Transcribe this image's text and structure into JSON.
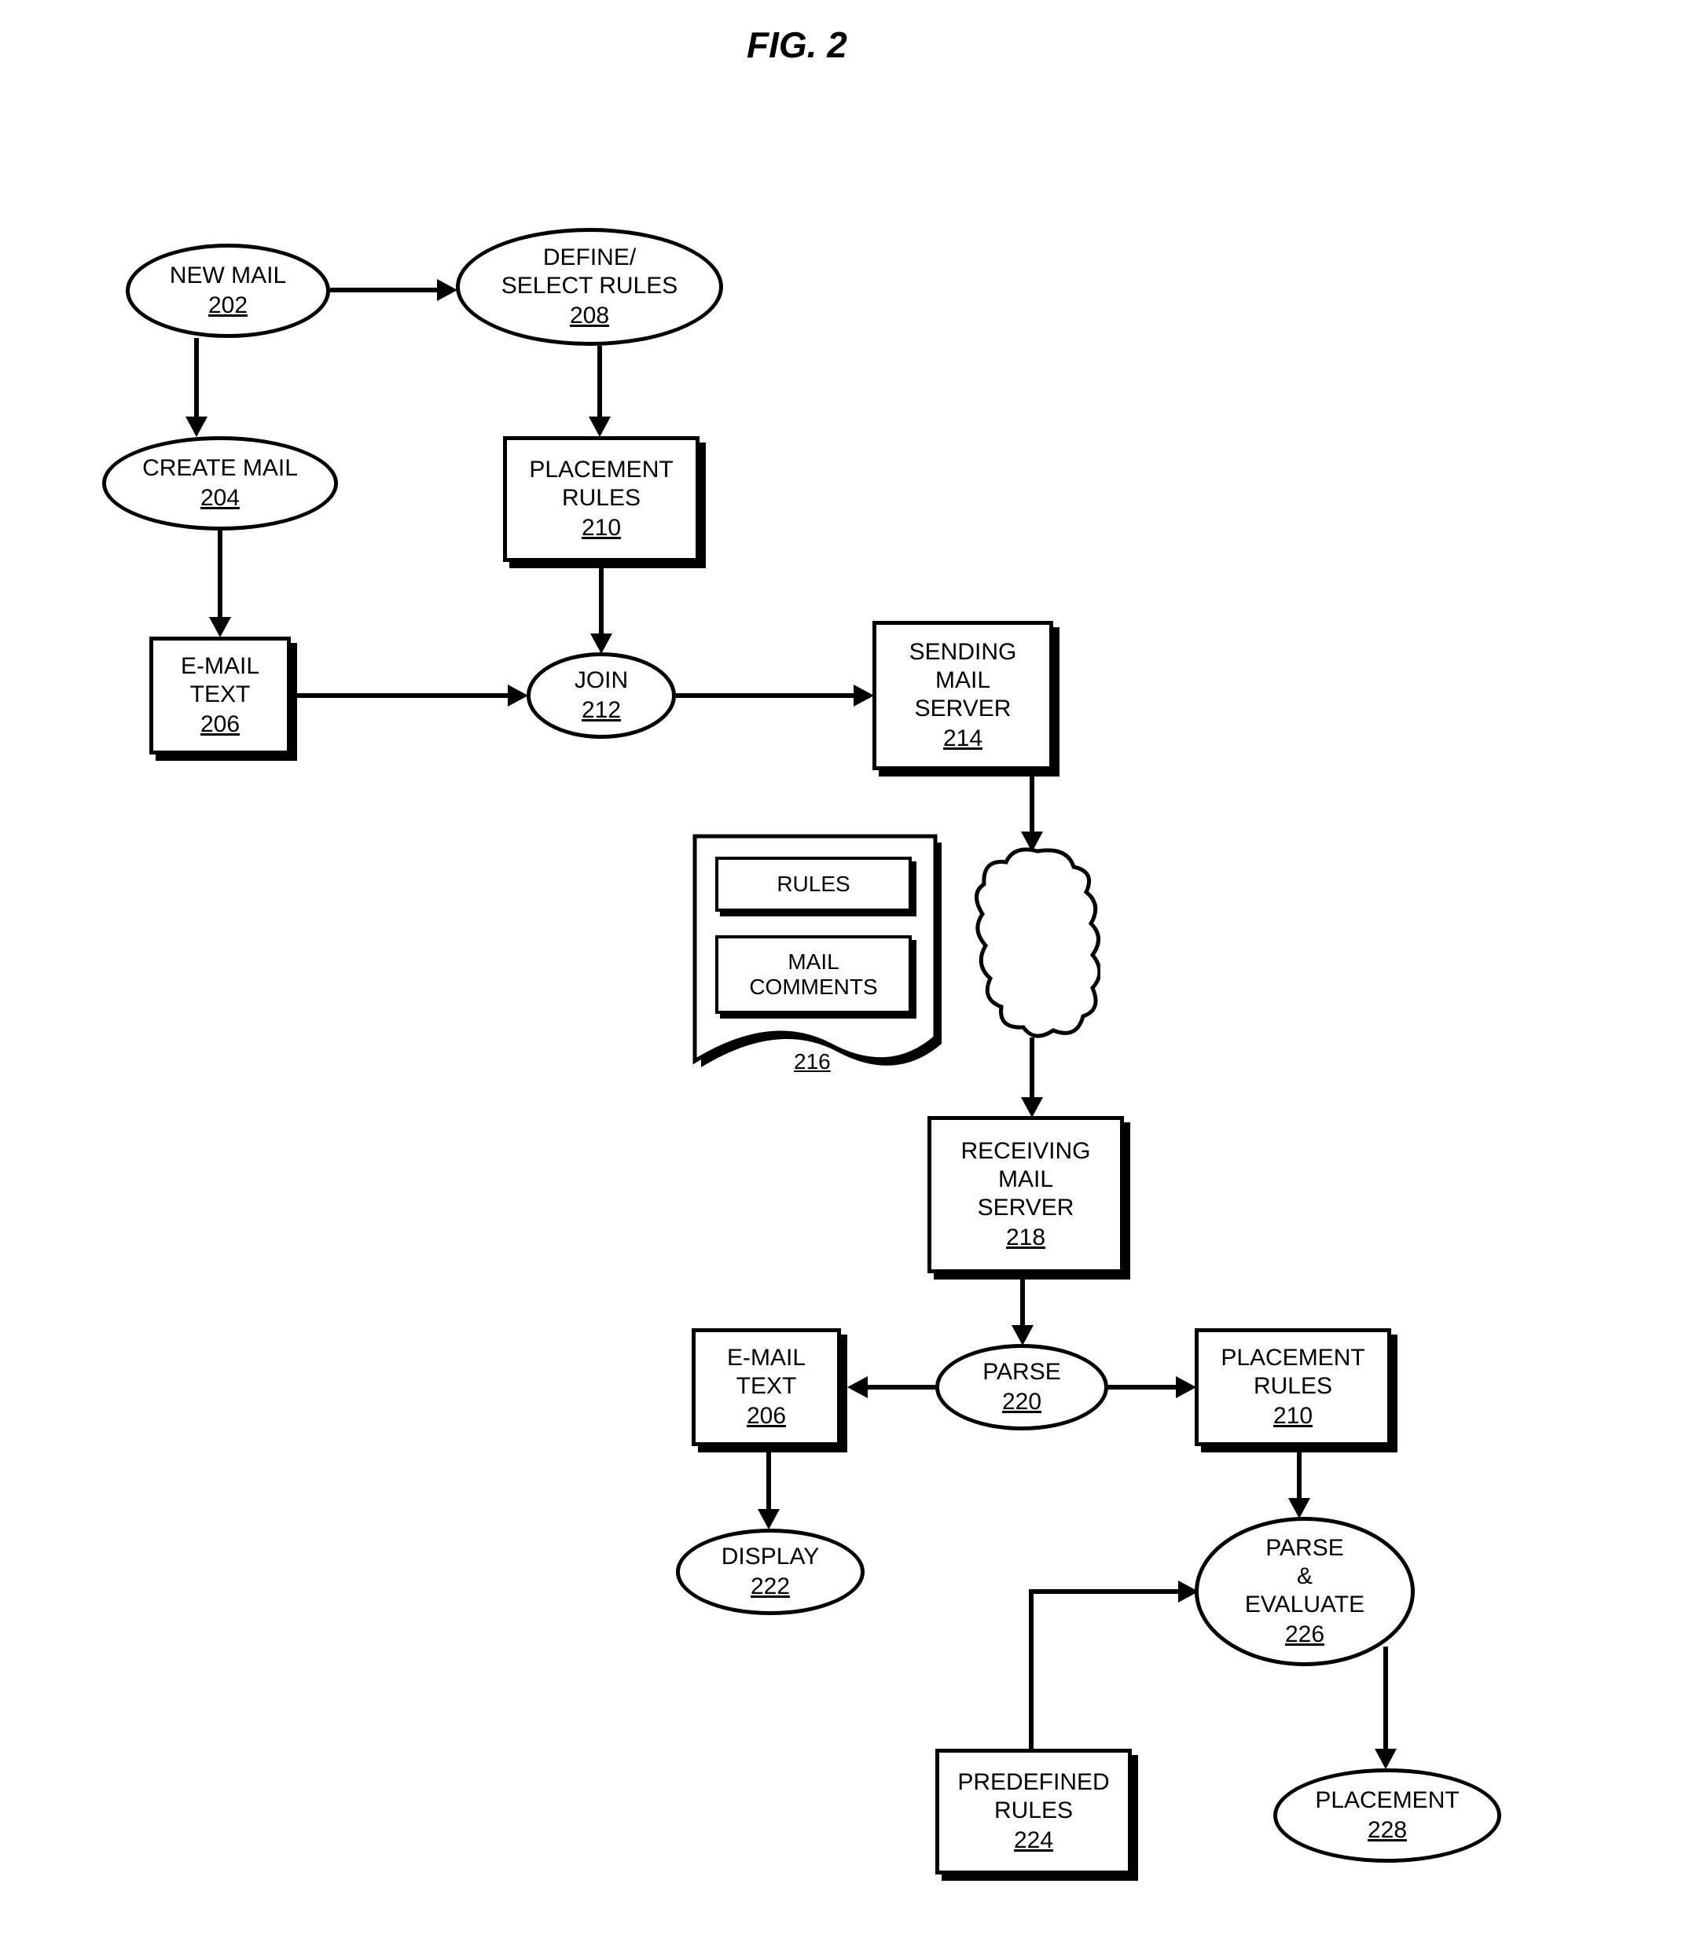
{
  "figure_title": "FIG. 2",
  "nodes": {
    "new_mail": {
      "label": "NEW MAIL",
      "ref": "202"
    },
    "create_mail": {
      "label": "CREATE MAIL",
      "ref": "204"
    },
    "email_text": {
      "label": "E-MAIL\nTEXT",
      "ref": "206"
    },
    "define_rules": {
      "label": "DEFINE/\nSELECT RULES",
      "ref": "208"
    },
    "placement_rules": {
      "label": "PLACEMENT\nRULES",
      "ref": "210"
    },
    "join": {
      "label": "JOIN",
      "ref": "212"
    },
    "sending_server": {
      "label": "SENDING\nMAIL\nSERVER",
      "ref": "214"
    },
    "doc": {
      "box1": "RULES",
      "box2": "MAIL\nCOMMENTS",
      "ref": "216"
    },
    "receiving_server": {
      "label": "RECEIVING\nMAIL\nSERVER",
      "ref": "218"
    },
    "parse": {
      "label": "PARSE",
      "ref": "220"
    },
    "email_text2": {
      "label": "E-MAIL\nTEXT",
      "ref": "206"
    },
    "placement_rules2": {
      "label": "PLACEMENT\nRULES",
      "ref": "210"
    },
    "display": {
      "label": "DISPLAY",
      "ref": "222"
    },
    "predefined_rules": {
      "label": "PREDEFINED\nRULES",
      "ref": "224"
    },
    "parse_evaluate": {
      "label": "PARSE\n&\nEVALUATE",
      "ref": "226"
    },
    "placement": {
      "label": "PLACEMENT",
      "ref": "228"
    }
  }
}
